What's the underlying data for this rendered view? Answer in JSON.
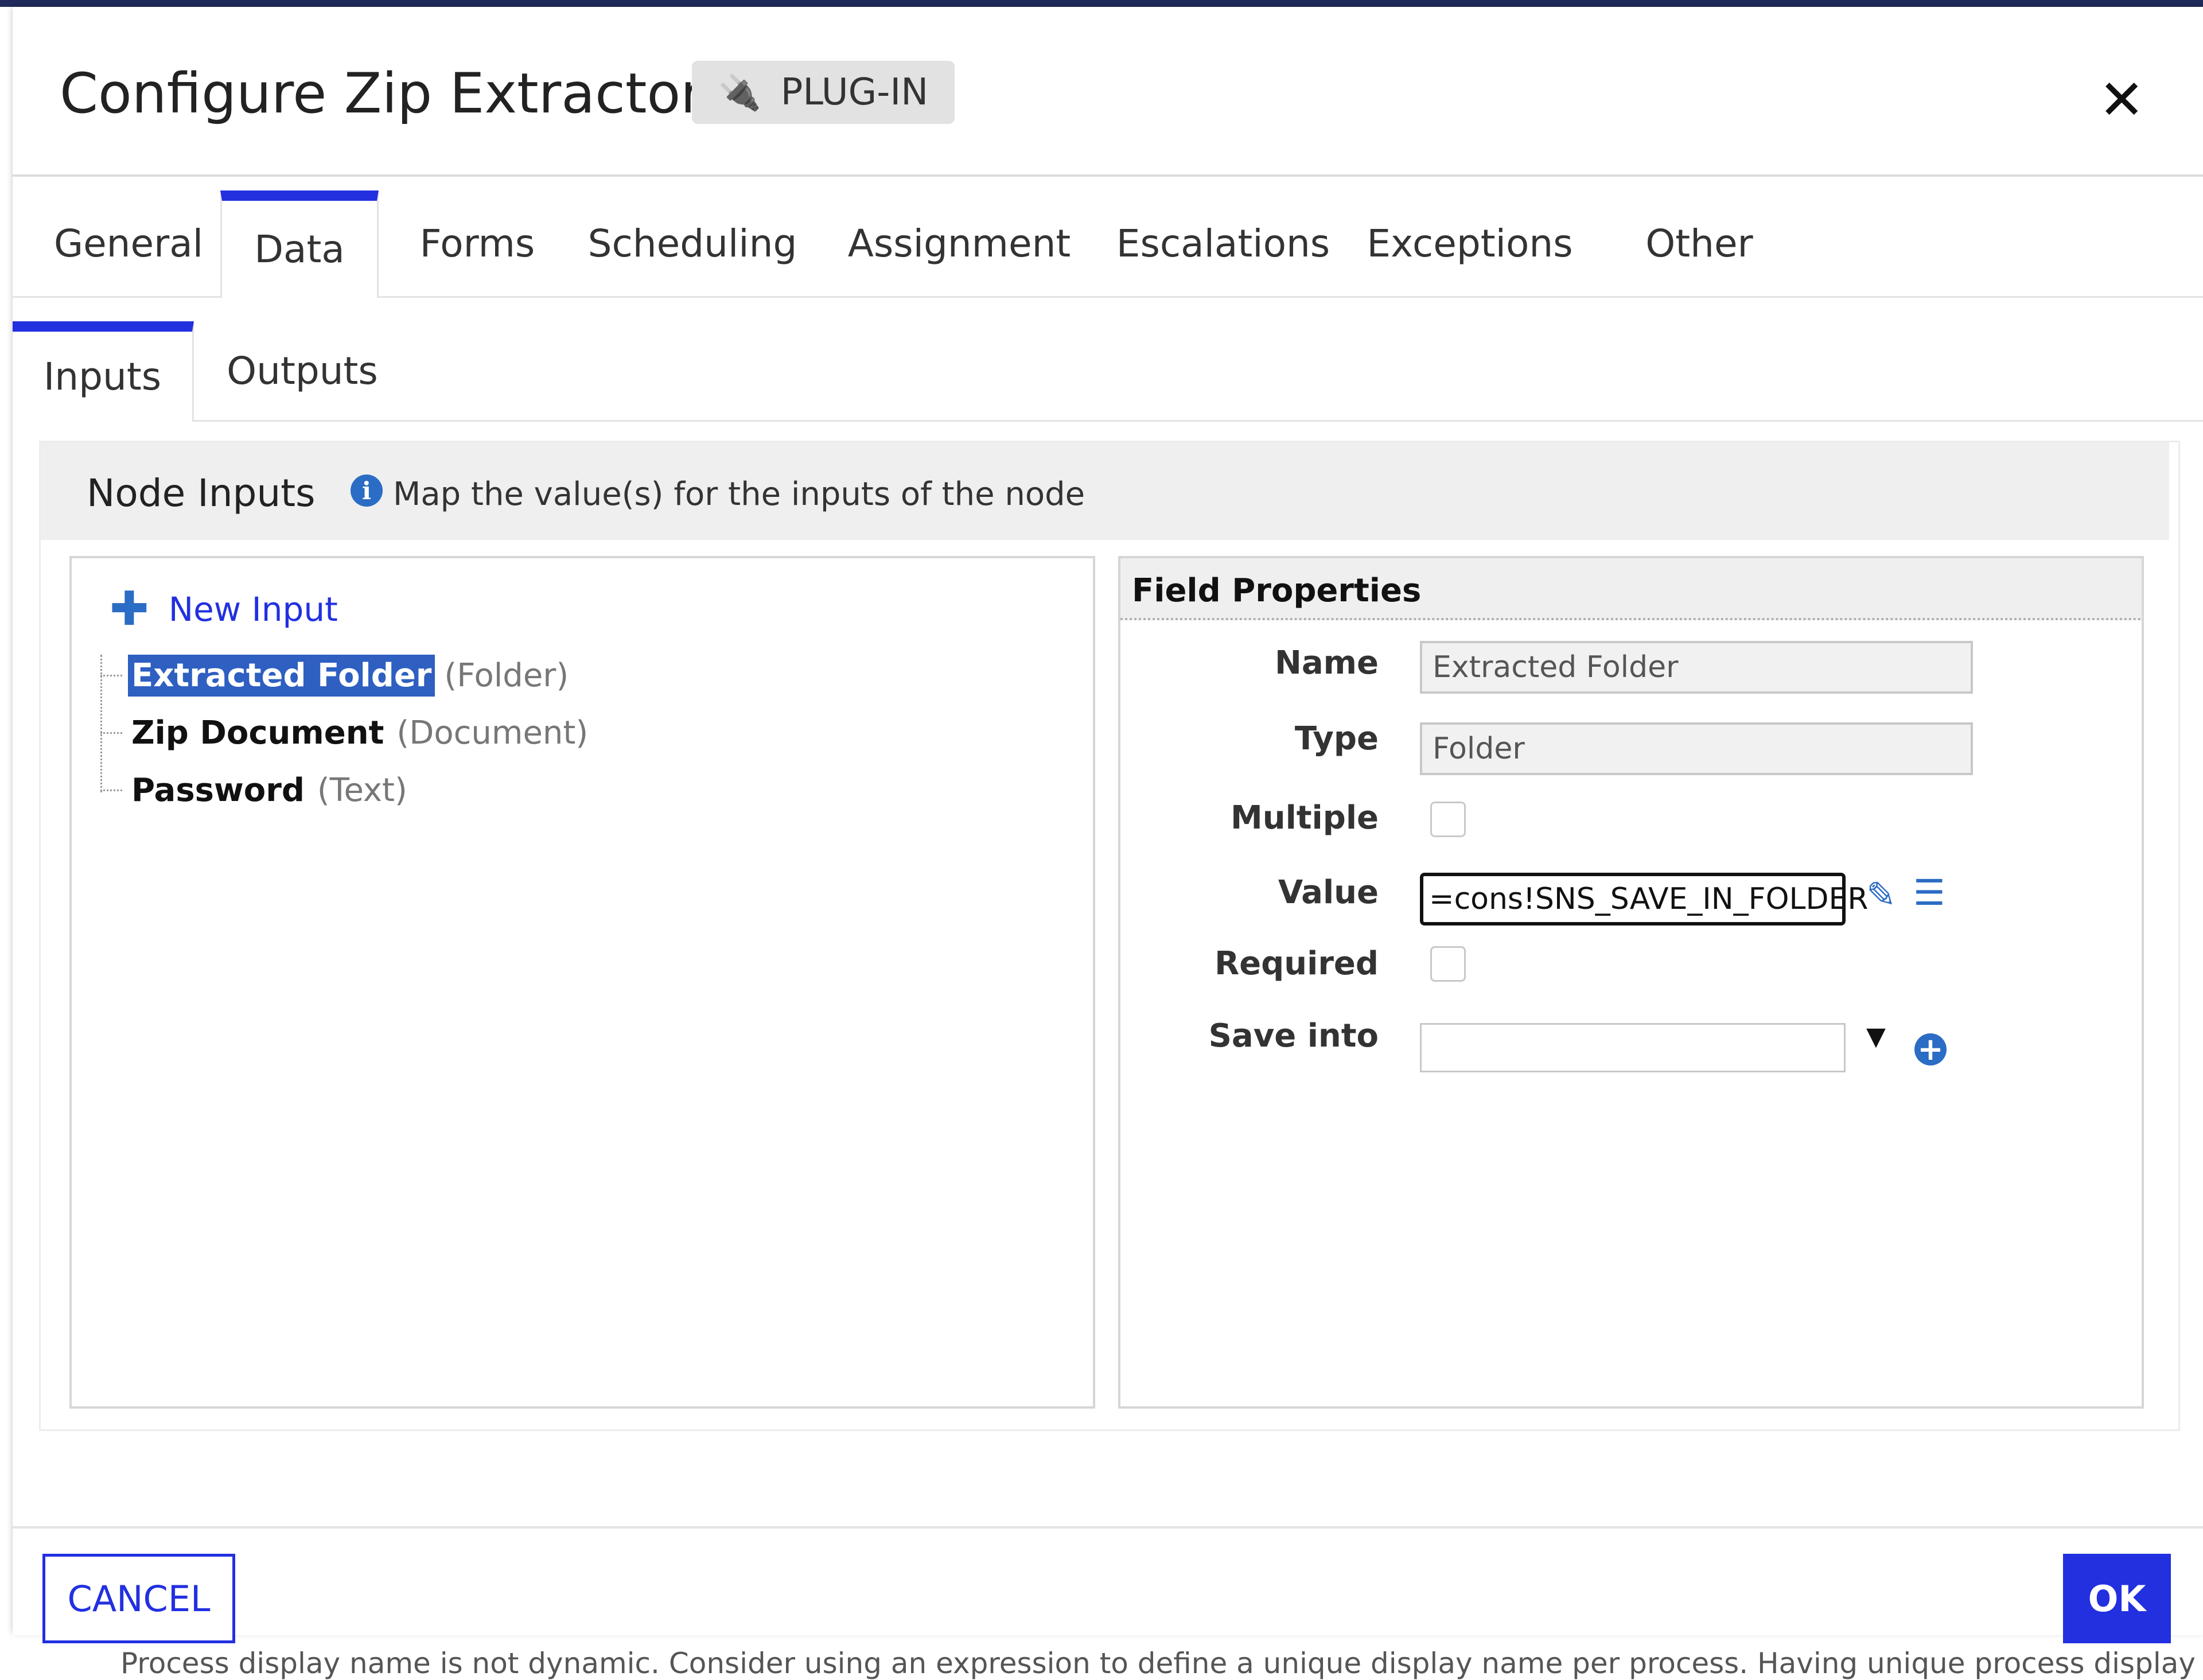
{
  "dialog": {
    "title": "Configure Zip Extractor",
    "badge": "PLUG-IN",
    "close_icon": "close-icon"
  },
  "tabs": [
    {
      "label": "General"
    },
    {
      "label": "Data"
    },
    {
      "label": "Forms"
    },
    {
      "label": "Scheduling"
    },
    {
      "label": "Assignment"
    },
    {
      "label": "Escalations"
    },
    {
      "label": "Exceptions"
    },
    {
      "label": "Other"
    }
  ],
  "active_tab": "Data",
  "subtabs": [
    {
      "label": "Inputs"
    },
    {
      "label": "Outputs"
    }
  ],
  "active_subtab": "Inputs",
  "node_inputs": {
    "title": "Node Inputs",
    "description": "Map the value(s) for the inputs of the node",
    "new_input_label": "New Input",
    "items": [
      {
        "name": "Extracted Folder",
        "type": "(Folder)",
        "selected": true
      },
      {
        "name": "Zip Document",
        "type": "(Document)",
        "selected": false
      },
      {
        "name": "Password",
        "type": "(Text)",
        "selected": false
      }
    ]
  },
  "field_properties": {
    "title": "Field Properties",
    "labels": {
      "name": "Name",
      "type": "Type",
      "multiple": "Multiple",
      "value": "Value",
      "required": "Required",
      "save_into": "Save into"
    },
    "name_value": "Extracted Folder",
    "type_value": "Folder",
    "multiple_checked": false,
    "value_expression": "=cons!SNS_SAVE_IN_FOLDER",
    "required_checked": false,
    "save_into_value": ""
  },
  "footer": {
    "cancel_label": "CANCEL",
    "ok_label": "OK"
  },
  "background_text": "Process display name is not dynamic. Consider using an expression to define a unique display name per process. Having unique process display n",
  "colors": {
    "accent": "#2230e0",
    "icon_blue": "#2b6cc4",
    "selection": "#2e5fc1"
  }
}
